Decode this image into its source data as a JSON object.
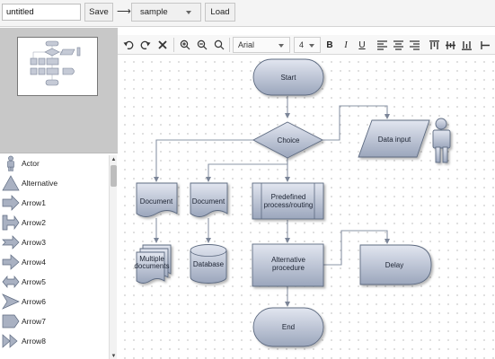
{
  "topbar": {
    "filename_value": "untitled",
    "save_label": "Save",
    "arrow": "⟶",
    "file_select_value": "sample",
    "load_label": "Load"
  },
  "toolbar": {
    "undo_icon": "undo-icon",
    "redo_icon": "redo-icon",
    "delete_icon": "delete-icon",
    "font_family": "Arial",
    "font_size": "4",
    "bold": "B",
    "italic": "I",
    "underline": "U"
  },
  "palette": {
    "items": [
      {
        "label": "Actor",
        "icon": "actor-icon"
      },
      {
        "label": "Alternative",
        "icon": "triangle-icon"
      },
      {
        "label": "Arrow1",
        "icon": "arrow1-icon"
      },
      {
        "label": "Arrow2",
        "icon": "arrow2-icon"
      },
      {
        "label": "Arrow3",
        "icon": "arrow3-icon"
      },
      {
        "label": "Arrow4",
        "icon": "arrow4-icon"
      },
      {
        "label": "Arrow5",
        "icon": "arrow5-icon"
      },
      {
        "label": "Arrow6",
        "icon": "arrow6-icon"
      },
      {
        "label": "Arrow7",
        "icon": "arrow7-icon"
      },
      {
        "label": "Arrow8",
        "icon": "arrow8-icon"
      }
    ]
  },
  "diagram": {
    "start": "Start",
    "choice": "Choice",
    "data_input": "Data input",
    "document1": "Document",
    "document2": "Document",
    "predefined_line1": "Predefined",
    "predefined_line2": "process/routing",
    "multiple_line1": "Multiple",
    "multiple_line2": "documents",
    "database": "Database",
    "alternative_line1": "Alternative",
    "alternative_line2": "procedure",
    "delay": "Delay",
    "end": "End"
  },
  "colors": {
    "shape_fill_top": "#dfe3ee",
    "shape_fill_bottom": "#9ea8bd",
    "shape_stroke": "#5d6a80",
    "connector": "#8a94a6"
  }
}
